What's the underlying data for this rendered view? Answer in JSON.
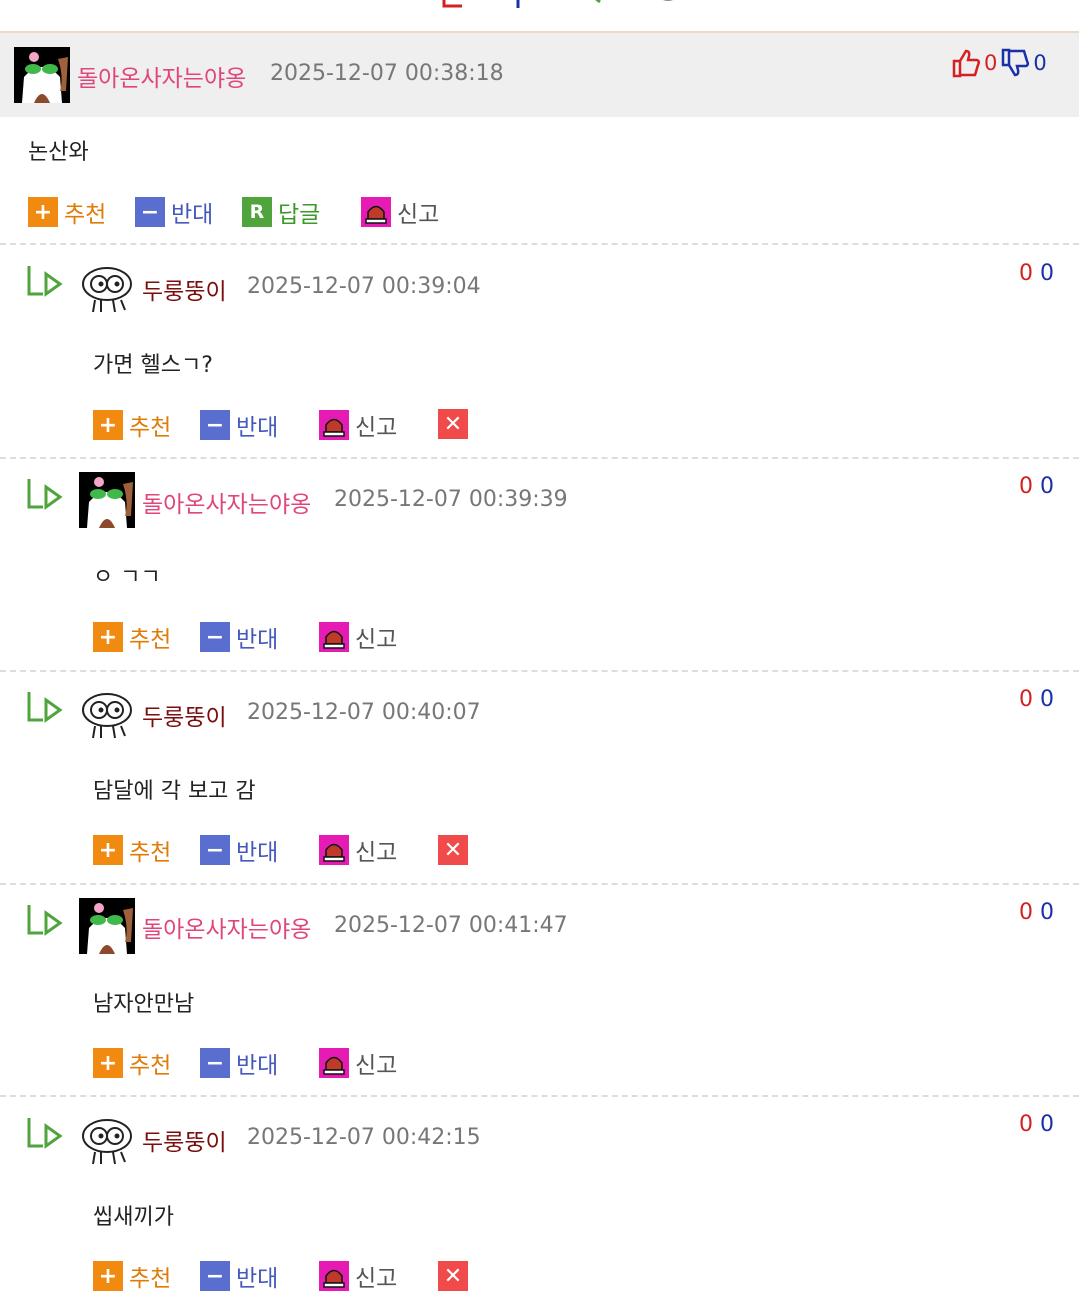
{
  "main_comment": {
    "nickname": "돌아온사자는야옹",
    "timestamp": "2025-12-07 00:38:18",
    "up_count": "0",
    "down_count": "0",
    "text": "논산와",
    "actions": {
      "recommend": "추천",
      "oppose": "반대",
      "reply": "답글",
      "report": "신고"
    }
  },
  "replies": [
    {
      "nickname": "두룽뚱이",
      "timestamp": "2025-12-07 00:39:04",
      "up": "0",
      "down": "0",
      "text": "가면 헬스ㄱ?",
      "recommend": "추천",
      "oppose": "반대",
      "report": "신고"
    },
    {
      "nickname": "돌아온사자는야옹",
      "timestamp": "2025-12-07 00:39:39",
      "up": "0",
      "down": "0",
      "text": "ㅇ ㄱㄱ",
      "recommend": "추천",
      "oppose": "반대",
      "report": "신고"
    },
    {
      "nickname": "두룽뚱이",
      "timestamp": "2025-12-07 00:40:07",
      "up": "0",
      "down": "0",
      "text": "담달에 각 보고 감",
      "recommend": "추천",
      "oppose": "반대",
      "report": "신고"
    },
    {
      "nickname": "돌아온사자는야옹",
      "timestamp": "2025-12-07 00:41:47",
      "up": "0",
      "down": "0",
      "text": "남자안만남",
      "recommend": "추천",
      "oppose": "반대",
      "report": "신고"
    },
    {
      "nickname": "두룽뚱이",
      "timestamp": "2025-12-07 00:42:15",
      "up": "0",
      "down": "0",
      "text": "씹새끼가",
      "recommend": "추천",
      "oppose": "반대",
      "report": "신고"
    }
  ],
  "colors": {
    "nick_main": "#e0457b",
    "nick_reply": "#7a0e0e",
    "recommend": "#f08a11",
    "oppose": "#5a6ed0",
    "reply": "#4fa53c",
    "report": "#e61bb3",
    "delete": "#f04a4a",
    "up": "#d42020",
    "down": "#1a2fa8"
  },
  "icons": {
    "thumb_up": "thumb-up-icon",
    "thumb_down": "thumb-down-icon",
    "reply_arrow": "reply-arrow-icon",
    "siren": "siren-icon",
    "delete": "close-icon"
  }
}
